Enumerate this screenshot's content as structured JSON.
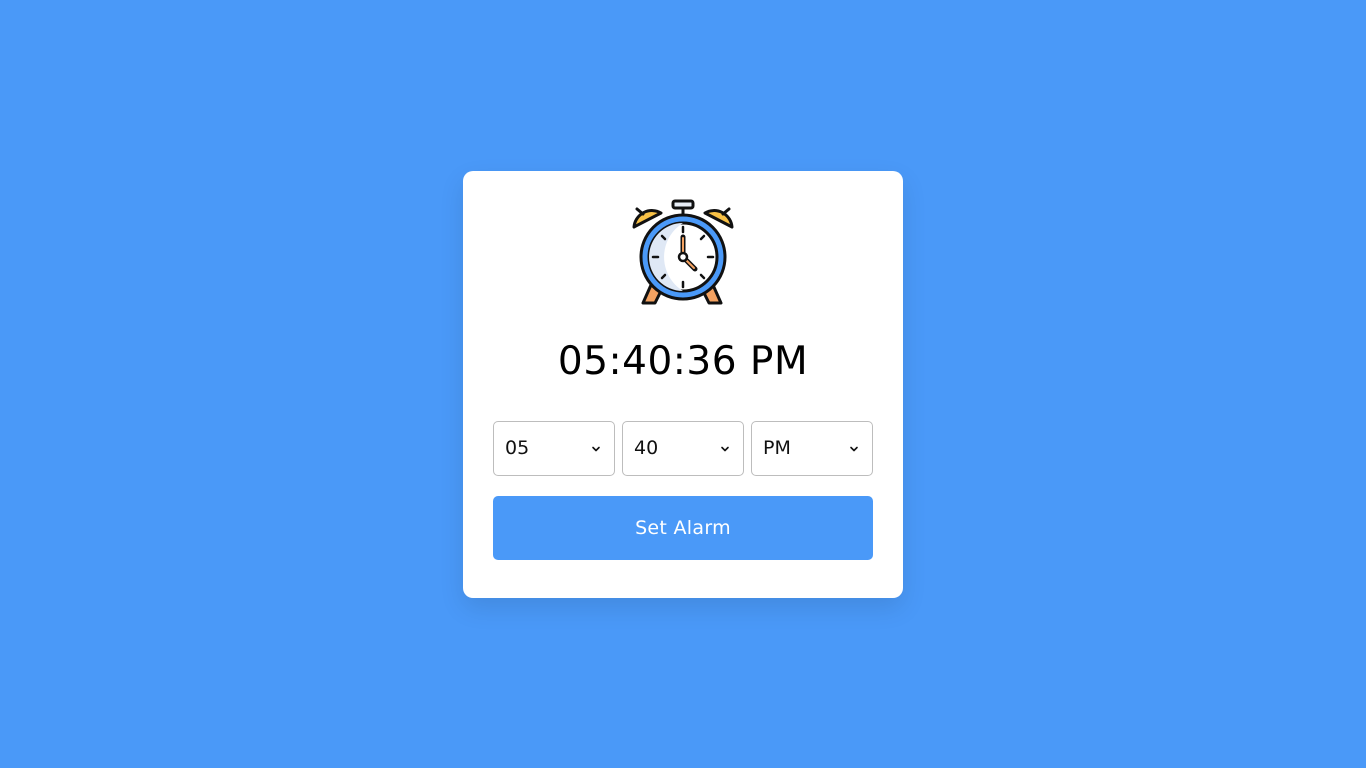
{
  "clock": {
    "current_time": "05:40:36 PM",
    "icon": "alarm-clock-icon"
  },
  "alarm_form": {
    "hour": {
      "value": "05"
    },
    "minute": {
      "value": "40"
    },
    "period": {
      "value": "PM"
    },
    "set_button_label": "Set Alarm"
  },
  "colors": {
    "background": "#4a99f8",
    "card": "#ffffff",
    "button": "#4a99f8"
  }
}
